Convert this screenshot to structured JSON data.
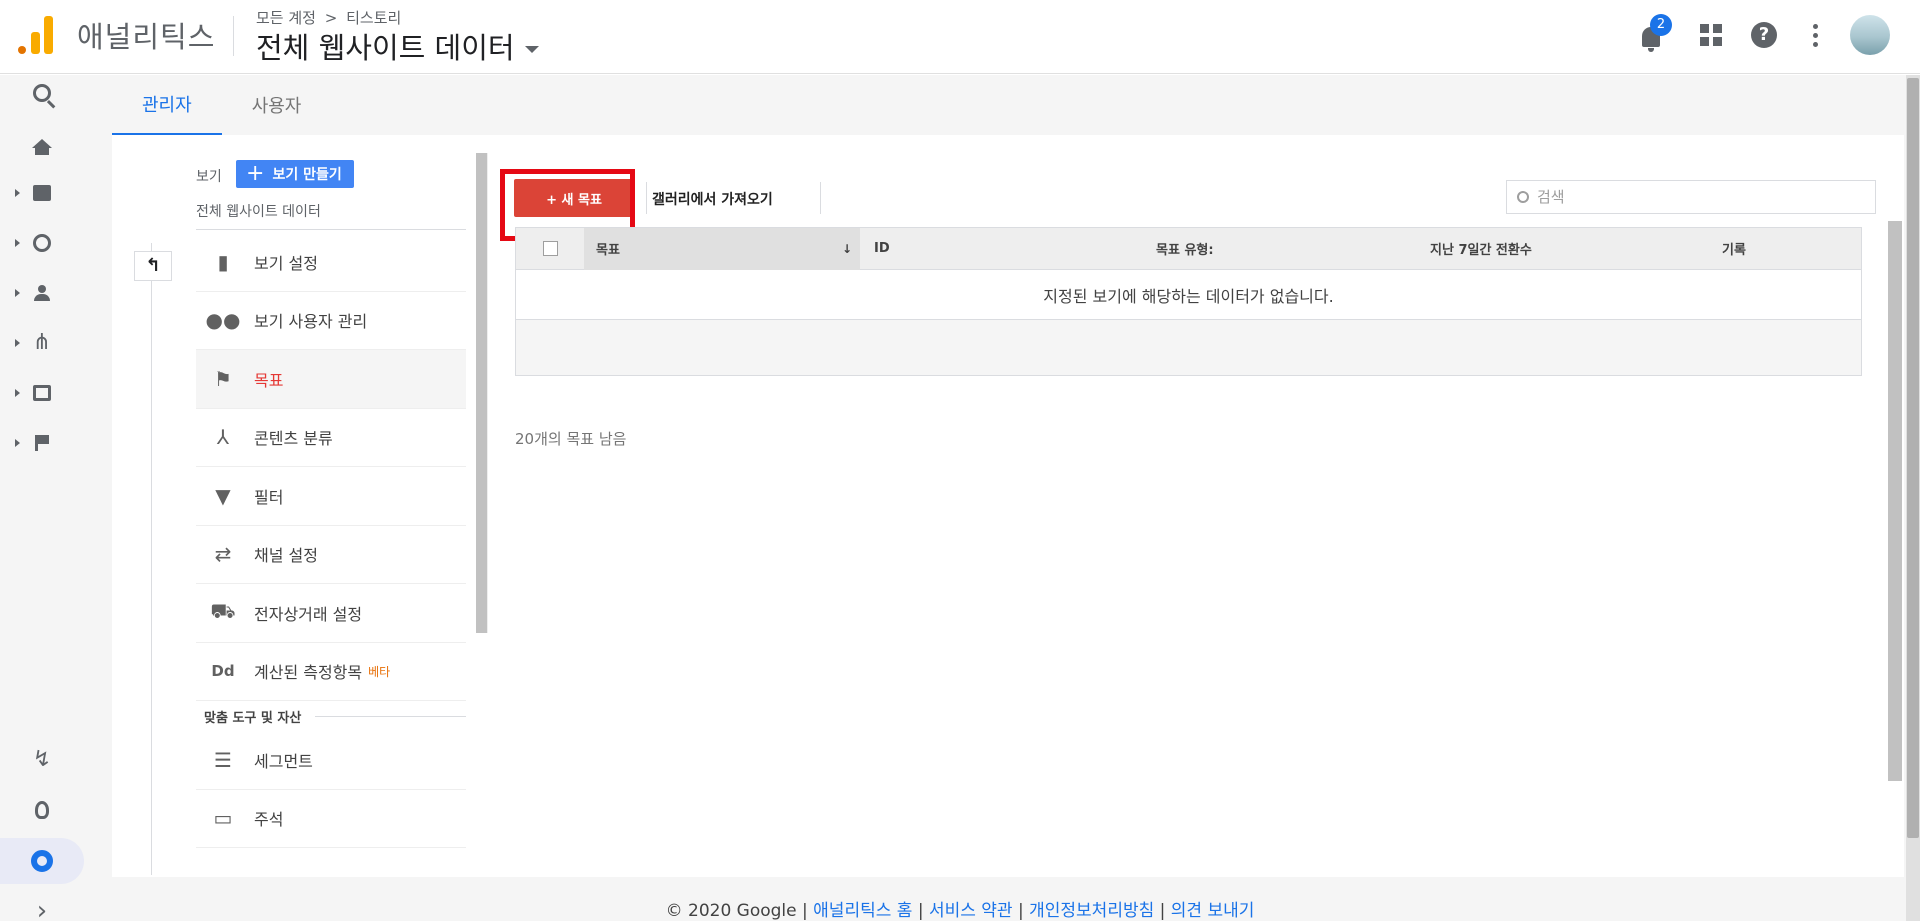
{
  "header": {
    "app_name": "애널리틱스",
    "breadcrumb": {
      "account": "모든 계정",
      "separator": ">",
      "property": "티스토리"
    },
    "view_title": "전체 웹사이트 데이터",
    "notification_count": "2"
  },
  "tabs": [
    {
      "label": "관리자",
      "active": true
    },
    {
      "label": "사용자",
      "active": false
    }
  ],
  "view_column": {
    "label": "보기",
    "create_button": "보기 만들기",
    "view_name": "전체 웹사이트 데이터",
    "back_label": "↰",
    "items": [
      {
        "label": "보기 설정",
        "icon": "document-icon"
      },
      {
        "label": "보기 사용자 관리",
        "icon": "people-icon"
      },
      {
        "label": "목표",
        "icon": "flag-icon",
        "active": true
      },
      {
        "label": "콘텐츠 분류",
        "icon": "content-grouping-icon"
      },
      {
        "label": "필터",
        "icon": "filter-icon"
      },
      {
        "label": "채널 설정",
        "icon": "channel-icon"
      },
      {
        "label": "전자상거래 설정",
        "icon": "cart-icon"
      },
      {
        "label": "계산된 측정항목",
        "icon": "dd-icon",
        "badge": "베타"
      }
    ],
    "section_title": "맞춤 도구 및 자산",
    "tool_items": [
      {
        "label": "세그먼트",
        "icon": "segment-icon"
      },
      {
        "label": "주석",
        "icon": "annotation-icon"
      }
    ]
  },
  "goals": {
    "new_goal_button": "+ 새 목표",
    "import_gallery": "갤러리에서 가져오기",
    "search_placeholder": "검색",
    "columns": [
      "목표",
      "ID",
      "목표 유형:",
      "지난 7일간 전환수",
      "기록"
    ],
    "sort_indicator": "↓",
    "empty_message": "지정된 보기에 해당하는 데이터가 없습니다.",
    "remaining": "20개의 목표 남음"
  },
  "footer": {
    "copyright": "© 2020 Google",
    "sep": " | ",
    "links": [
      "애널리틱스 홈",
      "서비스 약관",
      "개인정보처리방침",
      "의견 보내기"
    ]
  },
  "colors": {
    "accent": "#1a73e8",
    "new_goal_button": "#db4437",
    "highlight_box": "#e50914",
    "logo_orange": "#f9ab00"
  }
}
